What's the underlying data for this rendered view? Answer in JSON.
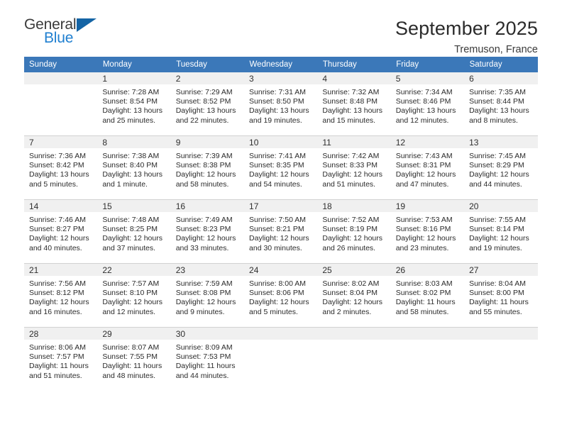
{
  "brand": {
    "name_part1": "General",
    "name_part2": "Blue",
    "triangle_color": "#1464a5",
    "blue_color": "#1f7fd0"
  },
  "header": {
    "title": "September 2025",
    "subtitle": "Tremuson, France",
    "header_bg_color": "#3b78b9",
    "daynum_bg_color": "#f0f0f0"
  },
  "calendar": {
    "weekday_headers": [
      "Sunday",
      "Monday",
      "Tuesday",
      "Wednesday",
      "Thursday",
      "Friday",
      "Saturday"
    ],
    "labels": {
      "sunrise": "Sunrise:",
      "sunset": "Sunset:",
      "daylight": "Daylight:"
    },
    "weeks": [
      [
        {
          "day": "",
          "sunrise": "",
          "sunset": "",
          "daylight_a": "",
          "daylight_b": ""
        },
        {
          "day": "1",
          "sunrise": "Sunrise: 7:28 AM",
          "sunset": "Sunset: 8:54 PM",
          "daylight_a": "Daylight: 13 hours",
          "daylight_b": "and 25 minutes."
        },
        {
          "day": "2",
          "sunrise": "Sunrise: 7:29 AM",
          "sunset": "Sunset: 8:52 PM",
          "daylight_a": "Daylight: 13 hours",
          "daylight_b": "and 22 minutes."
        },
        {
          "day": "3",
          "sunrise": "Sunrise: 7:31 AM",
          "sunset": "Sunset: 8:50 PM",
          "daylight_a": "Daylight: 13 hours",
          "daylight_b": "and 19 minutes."
        },
        {
          "day": "4",
          "sunrise": "Sunrise: 7:32 AM",
          "sunset": "Sunset: 8:48 PM",
          "daylight_a": "Daylight: 13 hours",
          "daylight_b": "and 15 minutes."
        },
        {
          "day": "5",
          "sunrise": "Sunrise: 7:34 AM",
          "sunset": "Sunset: 8:46 PM",
          "daylight_a": "Daylight: 13 hours",
          "daylight_b": "and 12 minutes."
        },
        {
          "day": "6",
          "sunrise": "Sunrise: 7:35 AM",
          "sunset": "Sunset: 8:44 PM",
          "daylight_a": "Daylight: 13 hours",
          "daylight_b": "and 8 minutes."
        }
      ],
      [
        {
          "day": "7",
          "sunrise": "Sunrise: 7:36 AM",
          "sunset": "Sunset: 8:42 PM",
          "daylight_a": "Daylight: 13 hours",
          "daylight_b": "and 5 minutes."
        },
        {
          "day": "8",
          "sunrise": "Sunrise: 7:38 AM",
          "sunset": "Sunset: 8:40 PM",
          "daylight_a": "Daylight: 13 hours",
          "daylight_b": "and 1 minute."
        },
        {
          "day": "9",
          "sunrise": "Sunrise: 7:39 AM",
          "sunset": "Sunset: 8:38 PM",
          "daylight_a": "Daylight: 12 hours",
          "daylight_b": "and 58 minutes."
        },
        {
          "day": "10",
          "sunrise": "Sunrise: 7:41 AM",
          "sunset": "Sunset: 8:35 PM",
          "daylight_a": "Daylight: 12 hours",
          "daylight_b": "and 54 minutes."
        },
        {
          "day": "11",
          "sunrise": "Sunrise: 7:42 AM",
          "sunset": "Sunset: 8:33 PM",
          "daylight_a": "Daylight: 12 hours",
          "daylight_b": "and 51 minutes."
        },
        {
          "day": "12",
          "sunrise": "Sunrise: 7:43 AM",
          "sunset": "Sunset: 8:31 PM",
          "daylight_a": "Daylight: 12 hours",
          "daylight_b": "and 47 minutes."
        },
        {
          "day": "13",
          "sunrise": "Sunrise: 7:45 AM",
          "sunset": "Sunset: 8:29 PM",
          "daylight_a": "Daylight: 12 hours",
          "daylight_b": "and 44 minutes."
        }
      ],
      [
        {
          "day": "14",
          "sunrise": "Sunrise: 7:46 AM",
          "sunset": "Sunset: 8:27 PM",
          "daylight_a": "Daylight: 12 hours",
          "daylight_b": "and 40 minutes."
        },
        {
          "day": "15",
          "sunrise": "Sunrise: 7:48 AM",
          "sunset": "Sunset: 8:25 PM",
          "daylight_a": "Daylight: 12 hours",
          "daylight_b": "and 37 minutes."
        },
        {
          "day": "16",
          "sunrise": "Sunrise: 7:49 AM",
          "sunset": "Sunset: 8:23 PM",
          "daylight_a": "Daylight: 12 hours",
          "daylight_b": "and 33 minutes."
        },
        {
          "day": "17",
          "sunrise": "Sunrise: 7:50 AM",
          "sunset": "Sunset: 8:21 PM",
          "daylight_a": "Daylight: 12 hours",
          "daylight_b": "and 30 minutes."
        },
        {
          "day": "18",
          "sunrise": "Sunrise: 7:52 AM",
          "sunset": "Sunset: 8:19 PM",
          "daylight_a": "Daylight: 12 hours",
          "daylight_b": "and 26 minutes."
        },
        {
          "day": "19",
          "sunrise": "Sunrise: 7:53 AM",
          "sunset": "Sunset: 8:16 PM",
          "daylight_a": "Daylight: 12 hours",
          "daylight_b": "and 23 minutes."
        },
        {
          "day": "20",
          "sunrise": "Sunrise: 7:55 AM",
          "sunset": "Sunset: 8:14 PM",
          "daylight_a": "Daylight: 12 hours",
          "daylight_b": "and 19 minutes."
        }
      ],
      [
        {
          "day": "21",
          "sunrise": "Sunrise: 7:56 AM",
          "sunset": "Sunset: 8:12 PM",
          "daylight_a": "Daylight: 12 hours",
          "daylight_b": "and 16 minutes."
        },
        {
          "day": "22",
          "sunrise": "Sunrise: 7:57 AM",
          "sunset": "Sunset: 8:10 PM",
          "daylight_a": "Daylight: 12 hours",
          "daylight_b": "and 12 minutes."
        },
        {
          "day": "23",
          "sunrise": "Sunrise: 7:59 AM",
          "sunset": "Sunset: 8:08 PM",
          "daylight_a": "Daylight: 12 hours",
          "daylight_b": "and 9 minutes."
        },
        {
          "day": "24",
          "sunrise": "Sunrise: 8:00 AM",
          "sunset": "Sunset: 8:06 PM",
          "daylight_a": "Daylight: 12 hours",
          "daylight_b": "and 5 minutes."
        },
        {
          "day": "25",
          "sunrise": "Sunrise: 8:02 AM",
          "sunset": "Sunset: 8:04 PM",
          "daylight_a": "Daylight: 12 hours",
          "daylight_b": "and 2 minutes."
        },
        {
          "day": "26",
          "sunrise": "Sunrise: 8:03 AM",
          "sunset": "Sunset: 8:02 PM",
          "daylight_a": "Daylight: 11 hours",
          "daylight_b": "and 58 minutes."
        },
        {
          "day": "27",
          "sunrise": "Sunrise: 8:04 AM",
          "sunset": "Sunset: 8:00 PM",
          "daylight_a": "Daylight: 11 hours",
          "daylight_b": "and 55 minutes."
        }
      ],
      [
        {
          "day": "28",
          "sunrise": "Sunrise: 8:06 AM",
          "sunset": "Sunset: 7:57 PM",
          "daylight_a": "Daylight: 11 hours",
          "daylight_b": "and 51 minutes."
        },
        {
          "day": "29",
          "sunrise": "Sunrise: 8:07 AM",
          "sunset": "Sunset: 7:55 PM",
          "daylight_a": "Daylight: 11 hours",
          "daylight_b": "and 48 minutes."
        },
        {
          "day": "30",
          "sunrise": "Sunrise: 8:09 AM",
          "sunset": "Sunset: 7:53 PM",
          "daylight_a": "Daylight: 11 hours",
          "daylight_b": "and 44 minutes."
        },
        {
          "day": "",
          "sunrise": "",
          "sunset": "",
          "daylight_a": "",
          "daylight_b": ""
        },
        {
          "day": "",
          "sunrise": "",
          "sunset": "",
          "daylight_a": "",
          "daylight_b": ""
        },
        {
          "day": "",
          "sunrise": "",
          "sunset": "",
          "daylight_a": "",
          "daylight_b": ""
        },
        {
          "day": "",
          "sunrise": "",
          "sunset": "",
          "daylight_a": "",
          "daylight_b": ""
        }
      ]
    ]
  }
}
